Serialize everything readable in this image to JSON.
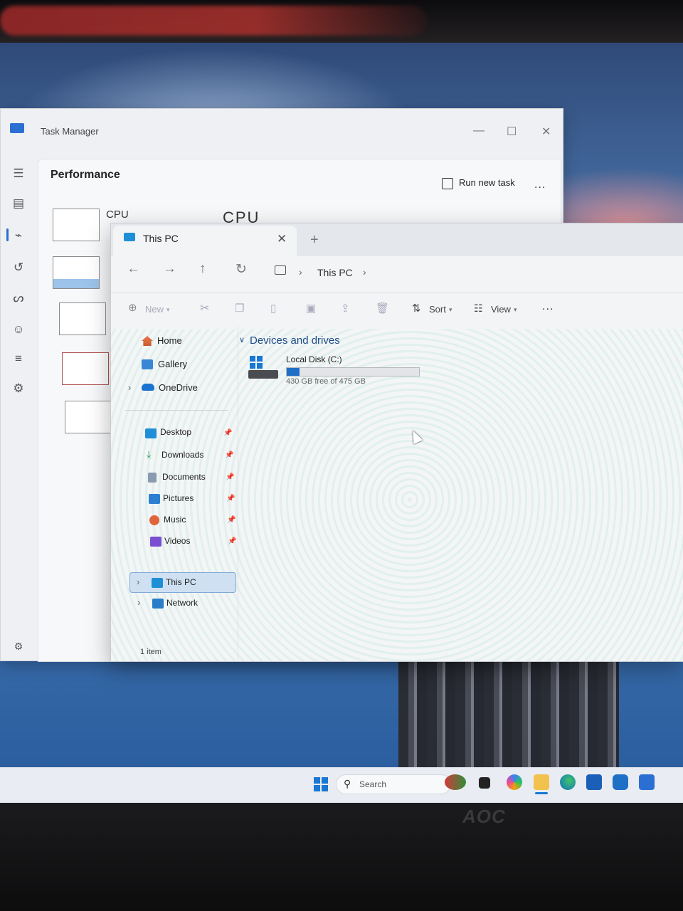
{
  "task_manager": {
    "title": "Task Manager",
    "page_title": "Performance",
    "run_new_task_label": "Run new task",
    "more_label": "...",
    "cpu_label": "CPU",
    "cpu_heading": "CPU",
    "nav_icons": [
      "hamburger-icon",
      "processes-icon",
      "performance-icon",
      "app-history-icon",
      "startup-apps-icon",
      "users-icon",
      "details-icon",
      "services-icon",
      "settings-icon"
    ]
  },
  "explorer": {
    "tab_title": "This PC",
    "breadcrumb": "This PC",
    "commands": {
      "new_label": "New",
      "sort_label": "Sort",
      "view_label": "View",
      "more_label": "..."
    },
    "sidebar": {
      "items": [
        {
          "label": "Home"
        },
        {
          "label": "Gallery"
        },
        {
          "label": "OneDrive"
        }
      ],
      "quick_access": [
        {
          "label": "Desktop"
        },
        {
          "label": "Downloads"
        },
        {
          "label": "Documents"
        },
        {
          "label": "Pictures"
        },
        {
          "label": "Music"
        },
        {
          "label": "Videos"
        }
      ],
      "this_pc_label": "This PC",
      "network_label": "Network"
    },
    "group_header": "Devices and drives",
    "drive": {
      "name": "Local Disk (C:)",
      "free_text": "430 GB free of 475 GB",
      "used_fraction": 0.095
    },
    "status_text": "1 item"
  },
  "taskbar": {
    "search_label": "Search"
  },
  "monitor_brand": "AOC",
  "colors": {
    "accent": "#1f6fc6",
    "selection": "#cfe0f2"
  }
}
